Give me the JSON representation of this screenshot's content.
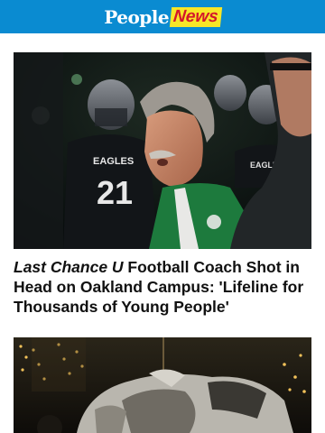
{
  "brand": {
    "logo_part1": "People",
    "logo_part2": "News",
    "header_color": "#0a8bd1"
  },
  "articles": [
    {
      "headline_italic": "Last Chance U",
      "headline_rest": " Football Coach Shot in Head on Oakland Campus: 'Lifeline for Thousands of Young People'",
      "jersey_text": "EAGLES",
      "jersey_number": "21",
      "jersey_text_2": "EAGLES"
    },
    {
      "headline_italic": "",
      "headline_rest": ""
    }
  ]
}
